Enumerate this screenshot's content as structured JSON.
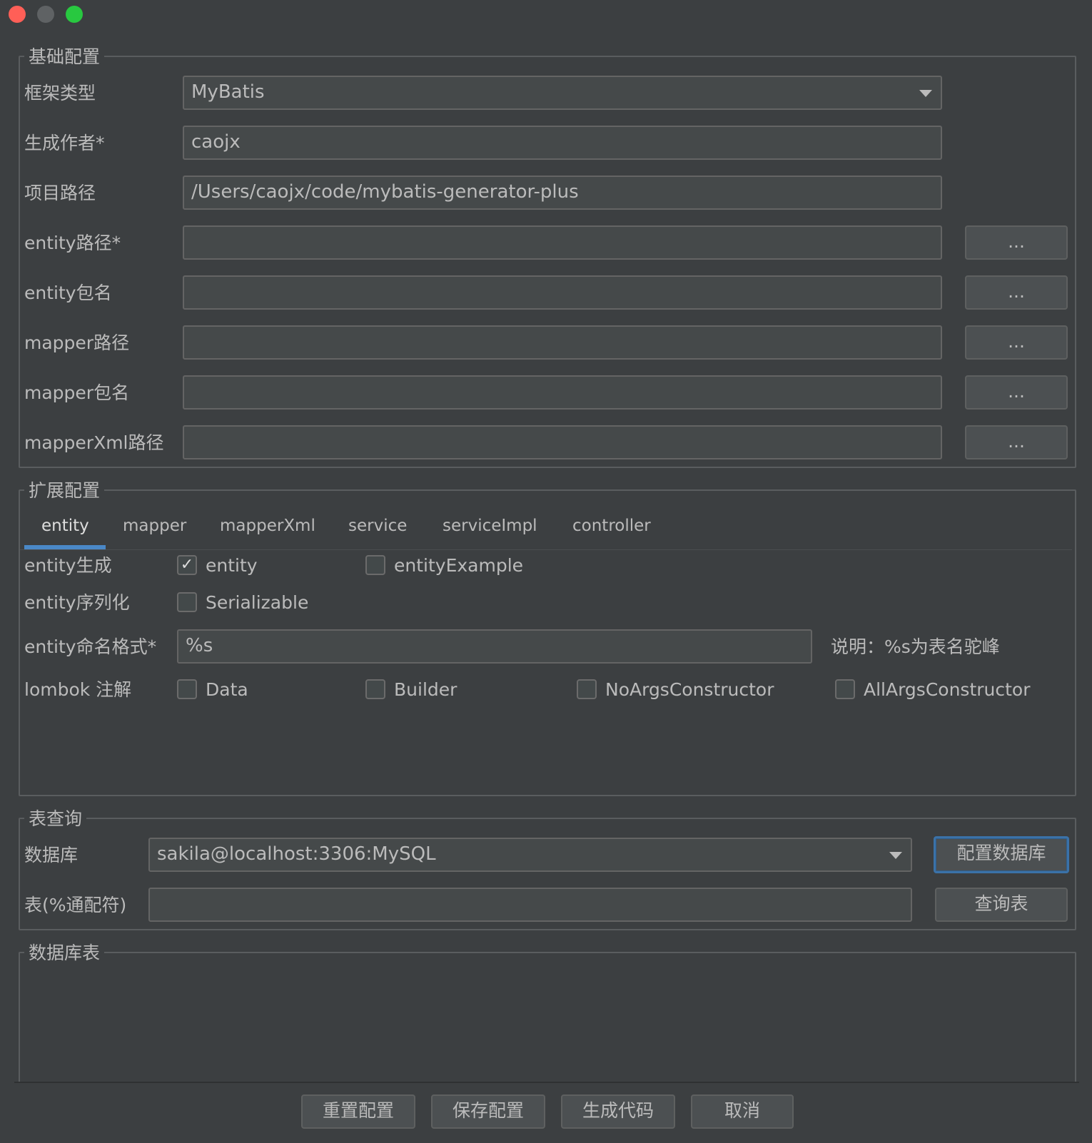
{
  "window": {
    "traffic_lights": {
      "close": "#ff5f57",
      "minimize": "#5f6264",
      "maximize": "#28c840"
    }
  },
  "basic": {
    "title": "基础配置",
    "framework": {
      "label": "框架类型",
      "value": "MyBatis"
    },
    "author": {
      "label": "生成作者*",
      "value": "caojx"
    },
    "project_path": {
      "label": "项目路径",
      "value": "/Users/caojx/code/mybatis-generator-plus"
    },
    "rows": [
      {
        "label": "entity路径*",
        "value": "",
        "browse": "..."
      },
      {
        "label": "entity包名",
        "value": "",
        "browse": "..."
      },
      {
        "label": "mapper路径",
        "value": "",
        "browse": "..."
      },
      {
        "label": "mapper包名",
        "value": "",
        "browse": "..."
      },
      {
        "label": "mapperXml路径",
        "value": "",
        "browse": "..."
      }
    ]
  },
  "extended": {
    "title": "扩展配置",
    "tabs": [
      "entity",
      "mapper",
      "mapperXml",
      "service",
      "serviceImpl",
      "controller"
    ],
    "active_tab": "entity",
    "generate": {
      "label": "entity生成",
      "entity": "entity",
      "entity_checked": true,
      "example": "entityExample",
      "example_checked": false
    },
    "serialize": {
      "label": "entity序列化",
      "option": "Serializable",
      "checked": false
    },
    "naming": {
      "label": "entity命名格式*",
      "value": "%s",
      "hint": "说明：%s为表名驼峰"
    },
    "lombok": {
      "label": "lombok 注解",
      "options": [
        "Data",
        "Builder",
        "NoArgsConstructor",
        "AllArgsConstructor"
      ]
    }
  },
  "query": {
    "title": "表查询",
    "db_label": "数据库",
    "db_value": "sakila@localhost:3306:MySQL",
    "config_db_button": "配置数据库",
    "table_label": "表(%通配符)",
    "table_value": "",
    "query_button": "查询表"
  },
  "db_tables": {
    "title": "数据库表"
  },
  "footer": {
    "reset": "重置配置",
    "save": "保存配置",
    "generate": "生成代码",
    "cancel": "取消"
  },
  "colors": {
    "accent": "#4a88c7",
    "background": "#3c3f41",
    "field": "#45494a"
  }
}
